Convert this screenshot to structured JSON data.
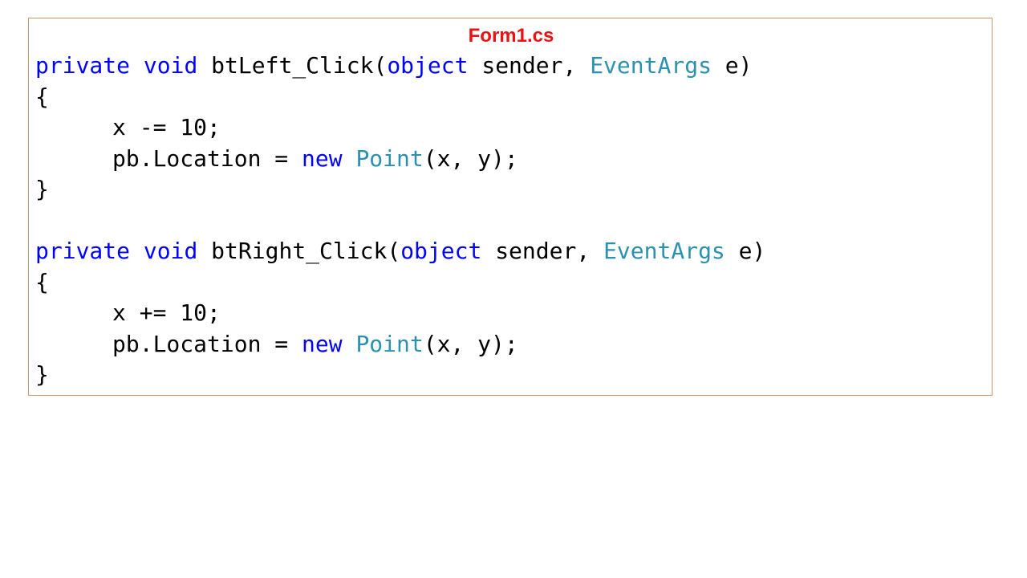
{
  "title": "Form1.cs",
  "colors": {
    "title": "#ee1111",
    "keyword": "#0000ff",
    "type": "#2b91af",
    "plain": "#000000",
    "border": "#c8956a"
  },
  "lines": [
    {
      "indent": false,
      "tokens": [
        {
          "text": "private",
          "kind": "kw"
        },
        {
          "text": " ",
          "kind": "plain"
        },
        {
          "text": "void",
          "kind": "kw"
        },
        {
          "text": " btLeft_Click(",
          "kind": "plain"
        },
        {
          "text": "object",
          "kind": "kw"
        },
        {
          "text": " sender, ",
          "kind": "plain"
        },
        {
          "text": "EventArgs",
          "kind": "ty"
        },
        {
          "text": " e)",
          "kind": "plain"
        }
      ]
    },
    {
      "indent": false,
      "tokens": [
        {
          "text": "{",
          "kind": "plain"
        }
      ]
    },
    {
      "indent": true,
      "tokens": [
        {
          "text": "x -= 10;",
          "kind": "plain"
        }
      ]
    },
    {
      "indent": true,
      "tokens": [
        {
          "text": "pb.Location = ",
          "kind": "plain"
        },
        {
          "text": "new",
          "kind": "kw"
        },
        {
          "text": " ",
          "kind": "plain"
        },
        {
          "text": "Point",
          "kind": "ty"
        },
        {
          "text": "(x, y);",
          "kind": "plain"
        }
      ]
    },
    {
      "indent": false,
      "tokens": [
        {
          "text": "}",
          "kind": "plain"
        }
      ]
    },
    {
      "indent": false,
      "tokens": []
    },
    {
      "indent": false,
      "tokens": [
        {
          "text": "private",
          "kind": "kw"
        },
        {
          "text": " ",
          "kind": "plain"
        },
        {
          "text": "void",
          "kind": "kw"
        },
        {
          "text": " btRight_Click(",
          "kind": "plain"
        },
        {
          "text": "object",
          "kind": "kw"
        },
        {
          "text": " sender, ",
          "kind": "plain"
        },
        {
          "text": "EventArgs",
          "kind": "ty"
        },
        {
          "text": " e)",
          "kind": "plain"
        }
      ]
    },
    {
      "indent": false,
      "tokens": [
        {
          "text": "{",
          "kind": "plain"
        }
      ]
    },
    {
      "indent": true,
      "tokens": [
        {
          "text": "x += 10;",
          "kind": "plain"
        }
      ]
    },
    {
      "indent": true,
      "tokens": [
        {
          "text": "pb.Location = ",
          "kind": "plain"
        },
        {
          "text": "new",
          "kind": "kw"
        },
        {
          "text": " ",
          "kind": "plain"
        },
        {
          "text": "Point",
          "kind": "ty"
        },
        {
          "text": "(x, y);",
          "kind": "plain"
        }
      ]
    },
    {
      "indent": false,
      "tokens": [
        {
          "text": "}",
          "kind": "plain"
        }
      ]
    }
  ]
}
